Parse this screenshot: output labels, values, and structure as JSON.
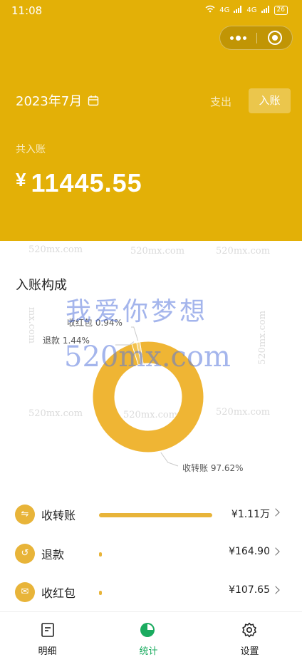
{
  "status_bar": {
    "time": "11:08",
    "network_1": "4G",
    "network_2": "4G",
    "battery": "26"
  },
  "header": {
    "month": "2023年7月",
    "tab_expense": "支出",
    "tab_income": "入账",
    "total_label": "共入账",
    "currency": "¥",
    "total_amount": "11445.55"
  },
  "section_title": "入账构成",
  "chart_data": {
    "type": "pie",
    "categories": [
      "收转账",
      "退款",
      "收红包"
    ],
    "values": [
      97.62,
      1.44,
      0.94
    ],
    "labels": [
      "收转账 97.62%",
      "退款 1.44%",
      "收红包 0.94%"
    ],
    "colors": [
      "#efb534",
      "#f2c24e",
      "#f6d480"
    ]
  },
  "list": [
    {
      "label": "收转账",
      "icon": "transfer-icon",
      "glyph": "⇋",
      "amount": "¥1.11万",
      "share": 0.9762
    },
    {
      "label": "退款",
      "icon": "refund-icon",
      "glyph": "↺",
      "amount": "¥164.90",
      "share": 0.0144
    },
    {
      "label": "收红包",
      "icon": "red-packet-icon",
      "glyph": "✉",
      "amount": "¥107.65",
      "share": 0.0094
    }
  ],
  "tabbar": {
    "details": "明细",
    "stats": "统计",
    "settings": "设置"
  },
  "watermarks": {
    "site": "520mx.com",
    "slogan": "我爱你梦想"
  },
  "colors": {
    "accent": "#e3b007",
    "chart": "#efb534",
    "active_tab": "#1aab5f"
  }
}
